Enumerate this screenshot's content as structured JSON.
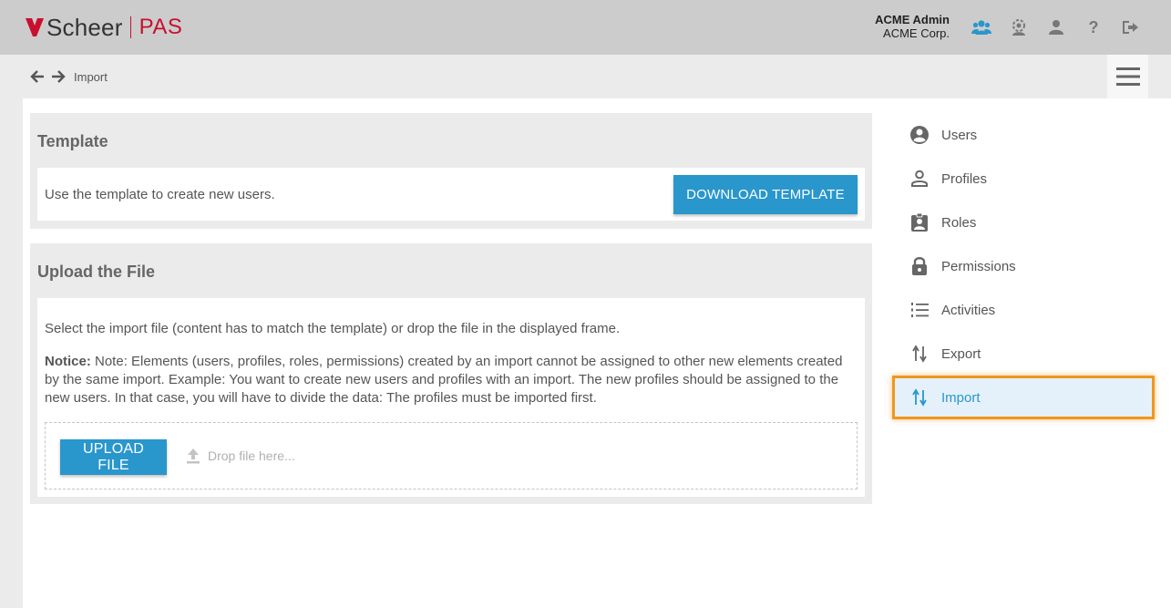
{
  "app": {
    "brand": "Scheer",
    "product": "PAS"
  },
  "user": {
    "name": "ACME Admin",
    "org": "ACME Corp."
  },
  "header_icons": [
    "users-group-icon",
    "settings-users-icon",
    "user-icon",
    "help-icon",
    "logout-icon"
  ],
  "breadcrumb": {
    "current": "Import"
  },
  "template_panel": {
    "title": "Template",
    "text": "Use the template to create new users.",
    "button": "DOWNLOAD TEMPLATE"
  },
  "upload_panel": {
    "title": "Upload the File",
    "intro": "Select the import file (content has to match the template) or drop the file in the displayed frame.",
    "notice_label": "Notice:",
    "notice_text": " Note: Elements (users, profiles, roles, permissions) created by an import cannot be assigned to other new elements created by the same import. Example: You want to create new users and profiles with an import. The new profiles should be assigned to the new users. In that case, you will have to divide the data: The profiles must be imported first.",
    "button": "UPLOAD FILE",
    "drop_hint": "Drop file here..."
  },
  "sidebar": {
    "items": [
      {
        "label": "Users",
        "icon": "account-circle-icon"
      },
      {
        "label": "Profiles",
        "icon": "person-outline-icon"
      },
      {
        "label": "Roles",
        "icon": "assignment-ind-icon"
      },
      {
        "label": "Permissions",
        "icon": "lock-icon"
      },
      {
        "label": "Activities",
        "icon": "list-numbered-icon"
      },
      {
        "label": "Export",
        "icon": "swap-vert-icon"
      },
      {
        "label": "Import",
        "icon": "swap-vert-icon",
        "active": true
      }
    ]
  },
  "colors": {
    "accent": "#2996cc",
    "brand_red": "#c8102e",
    "highlight": "#f0961e"
  }
}
